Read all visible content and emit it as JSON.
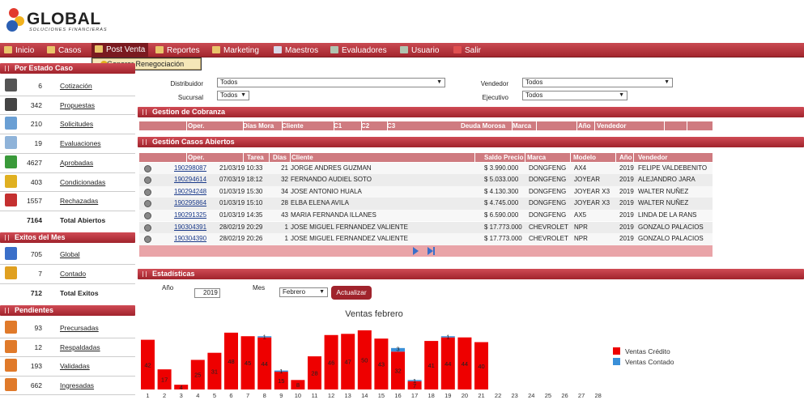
{
  "brand": {
    "name": "GLOBAL",
    "tagline": "SOLUCIONES FINANCIERAS"
  },
  "menu": [
    {
      "label": "Inicio",
      "icon": "home-icon",
      "color": "#e9c46a"
    },
    {
      "label": "Casos",
      "icon": "folder-icon",
      "color": "#e9c46a"
    },
    {
      "label": "Post Venta",
      "icon": "folder-icon",
      "color": "#e9c46a"
    },
    {
      "label": "Reportes",
      "icon": "folder-icon",
      "color": "#e9c46a"
    },
    {
      "label": "Marketing",
      "icon": "folder-icon",
      "color": "#e9c46a"
    },
    {
      "label": "Maestros",
      "icon": "document-icon",
      "color": "#d8d8e8"
    },
    {
      "label": "Evaluadores",
      "icon": "tools-icon",
      "color": "#b0c4b0"
    },
    {
      "label": "Usuario",
      "icon": "tools-icon",
      "color": "#b0c4b0"
    },
    {
      "label": "Salir",
      "icon": "exit-icon",
      "color": "#e05050"
    }
  ],
  "submenu": {
    "item": "Generar Renegociación"
  },
  "left": {
    "estado": {
      "title": "Por Estado Caso",
      "items": [
        {
          "count": "6",
          "label": "Cotización",
          "icon": "calculator-icon",
          "color": "#555"
        },
        {
          "count": "342",
          "label": "Propuestas",
          "icon": "calculator-icon",
          "color": "#444"
        },
        {
          "count": "210",
          "label": "Solicitudes",
          "icon": "document-pen-icon",
          "color": "#6a9fd4"
        },
        {
          "count": "19",
          "label": "Evaluaciones",
          "icon": "magnifier-icon",
          "color": "#8fb3d9"
        },
        {
          "count": "4627",
          "label": "Aprobadas",
          "icon": "shield-check-icon",
          "color": "#3a9a3a"
        },
        {
          "count": "403",
          "label": "Condicionadas",
          "icon": "shield-alert-icon",
          "color": "#e0b020"
        },
        {
          "count": "1557",
          "label": "Rechazadas",
          "icon": "shield-x-icon",
          "color": "#c43030"
        }
      ],
      "total": {
        "count": "7164",
        "label": "Total Abiertos"
      }
    },
    "exitos": {
      "title": "Exitos del Mes",
      "items": [
        {
          "count": "705",
          "label": "Global",
          "icon": "chart-trend-icon",
          "color": "#3a6fc9"
        },
        {
          "count": "7",
          "label": "Contado",
          "icon": "coin-icon",
          "color": "#e0a020"
        }
      ],
      "total": {
        "count": "712",
        "label": "Total Exitos"
      }
    },
    "pendientes": {
      "title": "Pendientes",
      "items": [
        {
          "count": "93",
          "label": "Precursadas",
          "icon": "folder-icon",
          "color": "#e07a2a"
        },
        {
          "count": "12",
          "label": "Respaldadas",
          "icon": "folder-icon",
          "color": "#e07a2a"
        },
        {
          "count": "193",
          "label": "Validadas",
          "icon": "folder-icon",
          "color": "#e07a2a"
        },
        {
          "count": "662",
          "label": "Ingresadas",
          "icon": "folder-icon",
          "color": "#e07a2a"
        }
      ]
    }
  },
  "filters": {
    "distribuidor": {
      "label": "Distribuidor",
      "value": "Todos"
    },
    "sucursal": {
      "label": "Sucursal",
      "value": "Todos"
    },
    "vendedor": {
      "label": "Vendedor",
      "value": "Todos"
    },
    "ejecutivo": {
      "label": "Ejecutivo",
      "value": "Todos"
    }
  },
  "cobranza": {
    "title": "Gestion de Cobranza",
    "headers": [
      "Oper.",
      "Días Mora",
      "Cliente",
      "C1",
      "C2",
      "C3",
      "Deuda Morosa",
      "Marca",
      "Año",
      "Vendedor"
    ]
  },
  "abiertos": {
    "title": "Gestión Casos Abiertos",
    "headers": [
      "Oper.",
      "Tarea",
      "Días",
      "Cliente",
      "Saldo Precio",
      "Marca",
      "Modelo",
      "Año",
      "Vendedor"
    ],
    "rows": [
      {
        "oper": "190298087",
        "tarea": "21/03/19 10:33",
        "dias": "21",
        "cliente": "JORGE ANDRES GUZMAN",
        "saldo": "$ 3.990.000",
        "marca": "DONGFENG",
        "modelo": "AX4",
        "anio": "2019",
        "vendedor": "FELIPE VALDEBENITO"
      },
      {
        "oper": "190294614",
        "tarea": "07/03/19 18:12",
        "dias": "32",
        "cliente": "FERNANDO AUDIEL SOTO",
        "saldo": "$ 5.033.000",
        "marca": "DONGFENG",
        "modelo": "JOYEAR",
        "anio": "2019",
        "vendedor": "ALEJANDRO JARA"
      },
      {
        "oper": "190294248",
        "tarea": "01/03/19 15:30",
        "dias": "34",
        "cliente": "JOSE ANTONIO HUALA",
        "saldo": "$ 4.130.300",
        "marca": "DONGFENG",
        "modelo": "JOYEAR X3",
        "anio": "2019",
        "vendedor": "WALTER NUÑEZ"
      },
      {
        "oper": "190295864",
        "tarea": "01/03/19 15:10",
        "dias": "28",
        "cliente": "ELBA ELENA AVILA",
        "saldo": "$ 4.745.000",
        "marca": "DONGFENG",
        "modelo": "JOYEAR X3",
        "anio": "2019",
        "vendedor": "WALTER NUÑEZ"
      },
      {
        "oper": "190291325",
        "tarea": "01/03/19 14:35",
        "dias": "43",
        "cliente": "MARIA FERNANDA ILLANES",
        "saldo": "$ 6.590.000",
        "marca": "DONGFENG",
        "modelo": "AX5",
        "anio": "2019",
        "vendedor": "LINDA DE LA RANS"
      },
      {
        "oper": "190304391",
        "tarea": "28/02/19 20:29",
        "dias": "1",
        "cliente": "JOSE MIGUEL FERNANDEZ VALIENTE",
        "saldo": "$ 17.773.000",
        "marca": "CHEVROLET",
        "modelo": "NPR",
        "anio": "2019",
        "vendedor": "GONZALO PALACIOS"
      },
      {
        "oper": "190304390",
        "tarea": "28/02/19 20:26",
        "dias": "1",
        "cliente": "JOSE MIGUEL FERNANDEZ VALIENTE",
        "saldo": "$ 17.773.000",
        "marca": "CHEVROLET",
        "modelo": "NPR",
        "anio": "2019",
        "vendedor": "GONZALO PALACIOS"
      }
    ]
  },
  "estadisticas": {
    "title": "Estadísticas",
    "anio_label": "Año",
    "anio_value": "2019",
    "mes_label": "Mes",
    "mes_value": "Febrero",
    "button": "Actualizar"
  },
  "chart_data": {
    "type": "bar",
    "title": "Ventas febrero",
    "categories": [
      "1",
      "2",
      "3",
      "4",
      "5",
      "6",
      "7",
      "8",
      "9",
      "10",
      "11",
      "12",
      "13",
      "14",
      "15",
      "16",
      "17",
      "18",
      "19",
      "20",
      "21",
      "22",
      "23",
      "24",
      "25",
      "26",
      "27",
      "28"
    ],
    "series": [
      {
        "name": "Ventas Crédito",
        "color": "#ee0000",
        "values": [
          42,
          17,
          4,
          25,
          31,
          48,
          45,
          44,
          15,
          8,
          28,
          46,
          47,
          50,
          43,
          32,
          7,
          41,
          44,
          44,
          40,
          0,
          0,
          0,
          0,
          0,
          0,
          0
        ]
      },
      {
        "name": "Ventas Contado",
        "color": "#3a8fd8",
        "values": [
          0,
          0,
          0,
          0,
          0,
          0,
          0,
          1,
          1,
          0,
          0,
          0,
          0,
          0,
          0,
          3,
          1,
          0,
          1,
          0,
          0,
          0,
          0,
          0,
          0,
          0,
          0,
          0
        ]
      }
    ],
    "stacked": true,
    "ylim": [
      0,
      52
    ],
    "legend": "right"
  }
}
